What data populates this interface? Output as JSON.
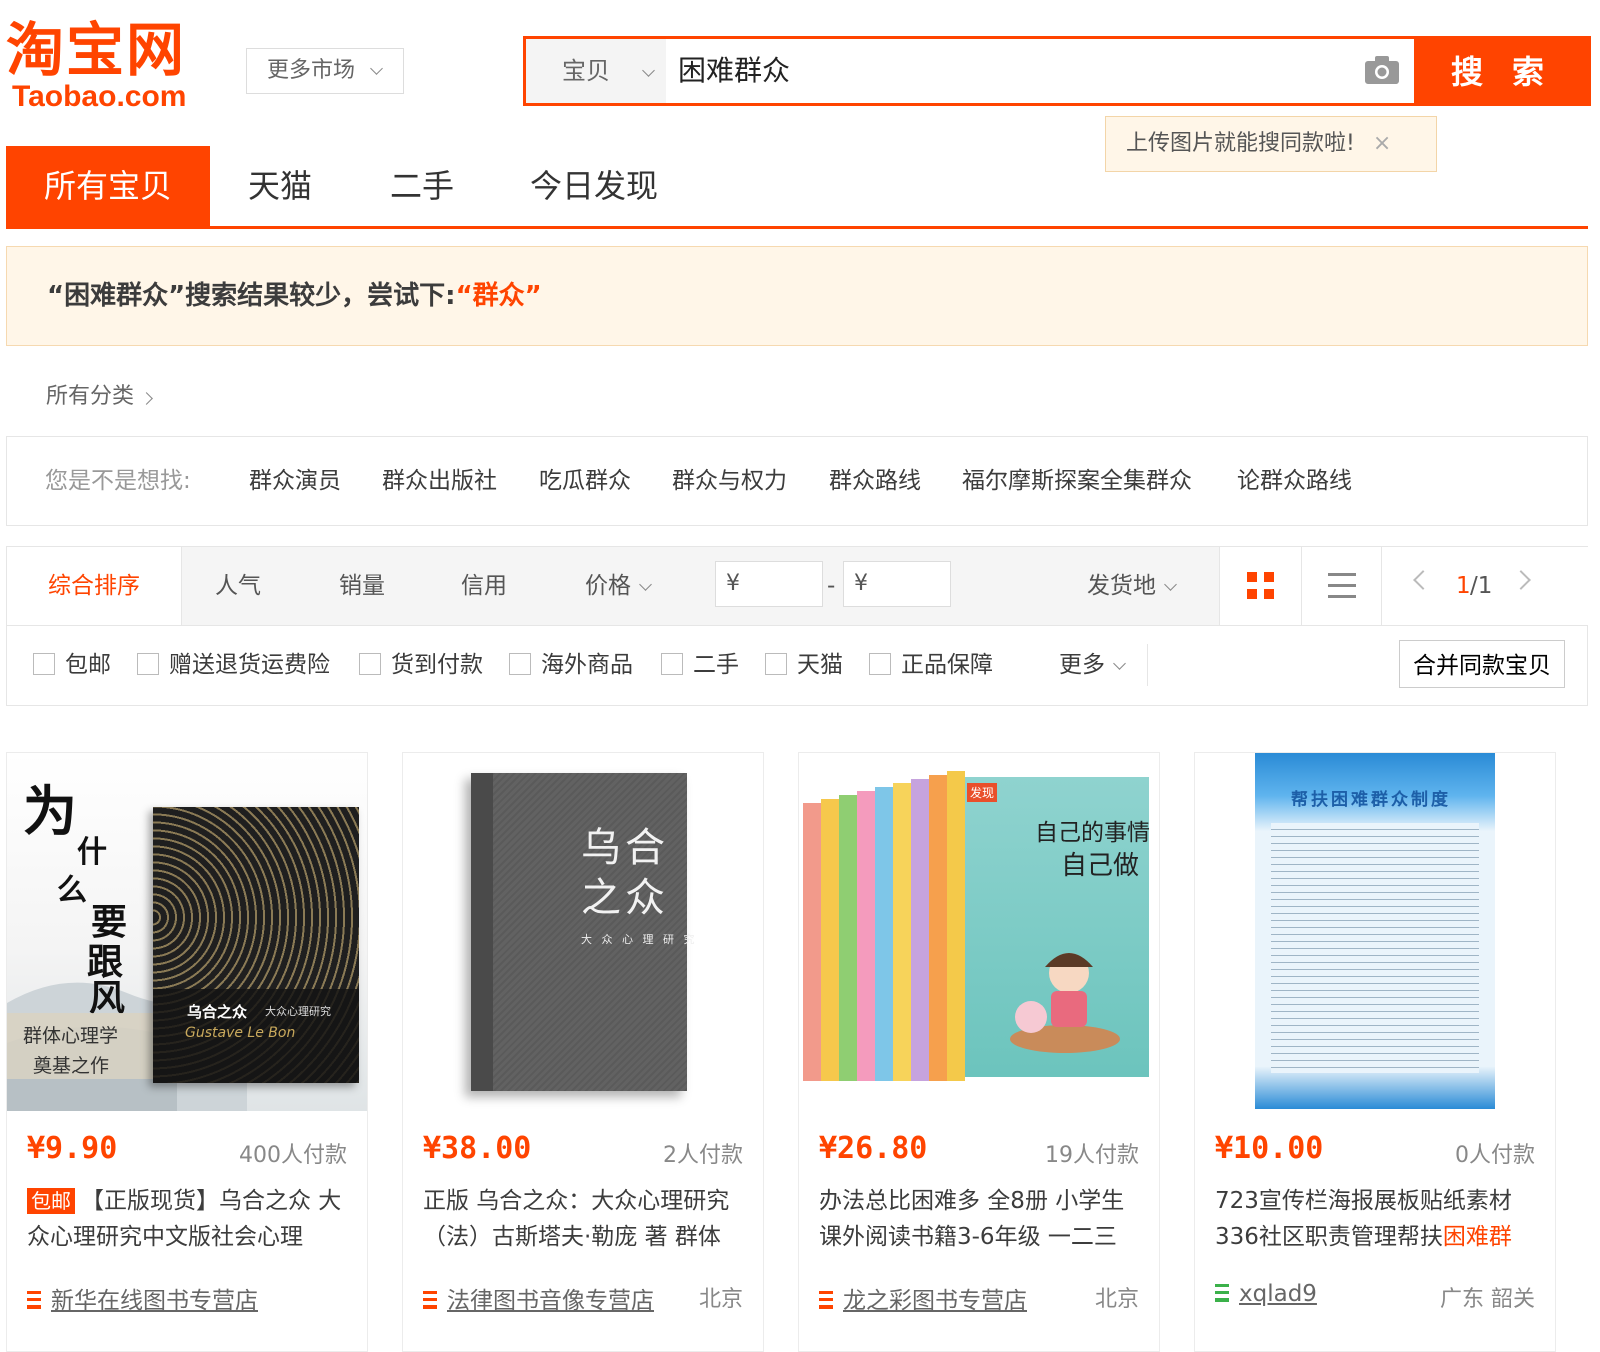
{
  "header": {
    "logo_cn": "淘宝网",
    "logo_en": "Taobao.com",
    "market_label": "更多市场",
    "search_category": "宝贝",
    "search_query": "困难群众",
    "search_button": "搜 索",
    "upload_tip": "上传图片就能搜同款啦!",
    "tip_close": "×"
  },
  "tabs": [
    "所有宝贝",
    "天猫",
    "二手",
    "今日发现"
  ],
  "banner": {
    "text": "“困难群众”搜索结果较少，尝试下:",
    "suggestion": "“群众”"
  },
  "breadcrumb": "所有分类",
  "related": {
    "label": "您是不是想找:",
    "keywords": [
      "群众演员",
      "群众出版社",
      "吃瓜群众",
      "群众与权力",
      "群众路线",
      "福尔摩斯探案全集群众",
      "论群众路线"
    ]
  },
  "sort": {
    "options": [
      "综合排序",
      "人气",
      "销量",
      "信用",
      "价格"
    ],
    "price_min_placeholder": "¥",
    "price_sep": "-",
    "price_max_placeholder": "¥",
    "ship_from": "发货地",
    "page_current": "1",
    "page_total": "/1"
  },
  "filters": {
    "checkboxes": [
      "包邮",
      "赠送退货运费险",
      "货到付款",
      "海外商品",
      "二手",
      "天猫",
      "正品保障"
    ],
    "more": "更多",
    "merge": "合并同款宝贝"
  },
  "products": [
    {
      "price": "¥9.90",
      "paid": "400人付款",
      "tag": "包邮",
      "title": "【正版现货】乌合之众 大众心理研究中文版社会心理",
      "shop": "新华在线图书专营店",
      "location": "",
      "img_text": {
        "v1": "为",
        "v2": "什",
        "v3": "么",
        "v4": "要",
        "v5": "跟",
        "v6": "风",
        "sub1": "群体心理学",
        "sub2": "奠基之作",
        "book": "乌合之众",
        "book_sub": "大众心理研究",
        "en": "Gustave Le Bon"
      }
    },
    {
      "price": "¥38.00",
      "paid": "2人付款",
      "tag": "",
      "title": "正版 乌合之众：大众心理研究（法）古斯塔夫·勒庞 著 群体",
      "shop": "法律图书音像专营店",
      "location": "北京",
      "img_text": {
        "t1": "乌合",
        "t2": "之众",
        "sub": "大 众 心 理 研 究"
      }
    },
    {
      "price": "¥26.80",
      "paid": "19人付款",
      "tag": "",
      "title": "办法总比困难多 全8册 小学生课外阅读书籍3-6年级 一二三",
      "shop": "龙之彩图书专营店",
      "location": "北京",
      "img_text": {
        "t1": "自己的事情",
        "t2": "自己做",
        "badge": "发现"
      }
    },
    {
      "price": "¥10.00",
      "paid": "0人付款",
      "tag": "",
      "title_pre": "723宣传栏海报展板贴纸素材336社区职责管理帮扶",
      "title_hl": "困难群",
      "shop": "xqlad9",
      "location": "广东 韶关",
      "img_text": {
        "t1": "帮扶困难群众制度"
      }
    }
  ],
  "colors": {
    "brand": "#ff4400",
    "banner_bg": "#fff6e8",
    "shop_icon_green": "#3bb14a"
  }
}
